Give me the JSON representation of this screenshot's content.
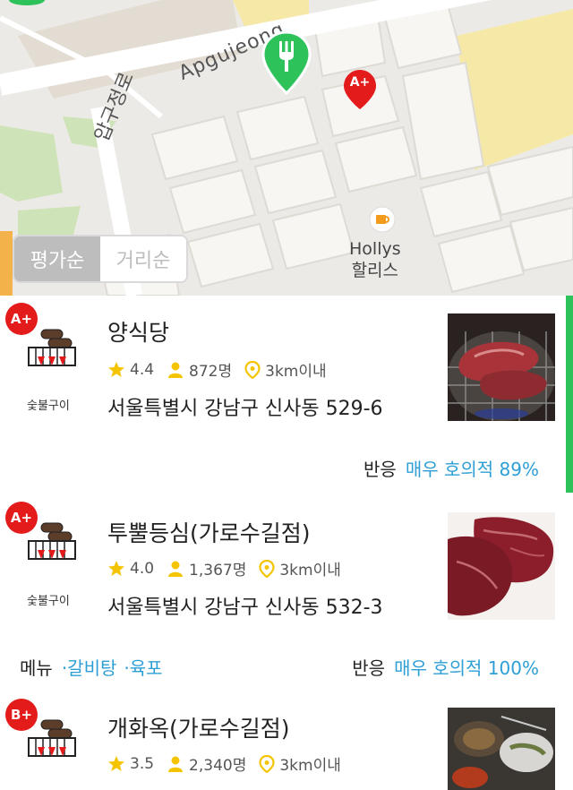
{
  "map": {
    "road_apgujeong": "Apgujeong",
    "road_apgujeongro": "압구정로",
    "poi_name_en": "Hollys",
    "poi_name_kr": "할리스",
    "red_pin_grade": "A+",
    "pins": [
      {
        "type": "fork-knife",
        "color": "#2ec25b"
      },
      {
        "type": "grade",
        "color": "#e31b1b"
      }
    ]
  },
  "sort": {
    "active_label": "평가순",
    "inactive_label": "거리순"
  },
  "colors": {
    "accent_green": "#2ec25b",
    "grade_red": "#e31b1b",
    "link_blue": "#2e9fd6",
    "star_yellow": "#f5c400"
  },
  "restaurants": [
    {
      "grade": "A+",
      "category": "숯불구이",
      "name": "양식당",
      "rating": "4.4",
      "reviewers": "872명",
      "distance": "3km이내",
      "address": "서울특별시 강남구 신사동 529-6",
      "reaction_label": "반응",
      "reaction_value": "매우 호의적 89%"
    },
    {
      "grade": "A+",
      "category": "숯불구이",
      "name": "투뿔등심(가로수길점)",
      "rating": "4.0",
      "reviewers": "1,367명",
      "distance": "3km이내",
      "address": "서울특별시 강남구 신사동 532-3",
      "menu_label": "메뉴",
      "menu_items": [
        "·갈비탕",
        "·육포"
      ],
      "reaction_label": "반응",
      "reaction_value": "매우 호의적 100%"
    },
    {
      "grade": "B+",
      "category": "숯불구이",
      "name": "개화옥(가로수길점)",
      "rating": "3.5",
      "reviewers": "2,340명",
      "distance": "3km이내"
    }
  ]
}
